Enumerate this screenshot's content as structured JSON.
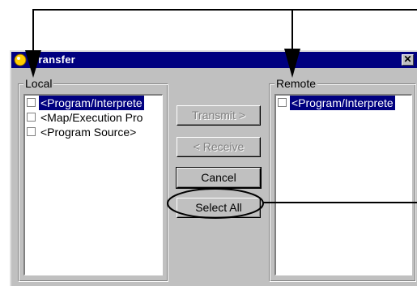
{
  "window": {
    "title": "Transfer",
    "close_glyph": "✕"
  },
  "local": {
    "label": "Local",
    "items": [
      {
        "label": "<Program/Interprete",
        "selected": true
      },
      {
        "label": "<Map/Execution Pro",
        "selected": false
      },
      {
        "label": "<Program Source>",
        "selected": false
      }
    ]
  },
  "remote": {
    "label": "Remote",
    "items": [
      {
        "label": "<Program/Interprete",
        "selected": true
      }
    ]
  },
  "buttons": {
    "transmit": "Transmit >",
    "receive": "< Receive",
    "cancel": "Cancel",
    "select_all": "Select All"
  }
}
